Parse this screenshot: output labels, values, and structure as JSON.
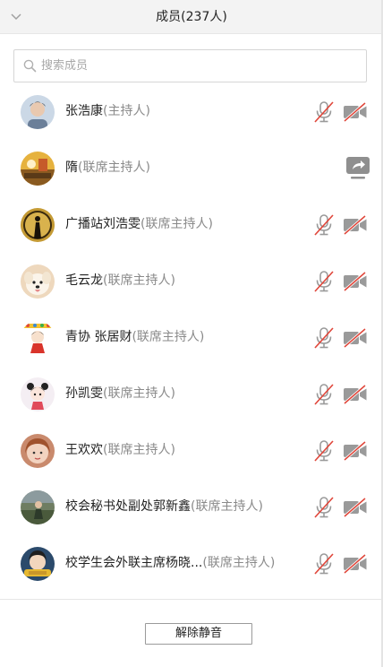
{
  "header": {
    "title": "成员(237人)",
    "collapse_icon": "chevron-down-icon"
  },
  "search": {
    "placeholder": "搜索成员",
    "value": "",
    "icon": "search-icon"
  },
  "members": [
    {
      "name": "张浩康",
      "role": "(主持人)",
      "mic": "muted",
      "camera": "off",
      "avatar_color": "#c9d7e6"
    },
    {
      "name": "隋",
      "role": "(联席主持人)",
      "status": "screen-sharing",
      "avatar_color": "#d9a53a"
    },
    {
      "name": "广播站刘浩雯",
      "role": "(联席主持人)",
      "mic": "muted",
      "camera": "off",
      "avatar_color": "#b38a2f"
    },
    {
      "name": "毛云龙",
      "role": "(联席主持人)",
      "mic": "muted",
      "camera": "off",
      "avatar_color": "#e8c6a0"
    },
    {
      "name": "青协 张居财",
      "role": "(联席主持人)",
      "mic": "muted",
      "camera": "off",
      "avatar_color": "#ffffff"
    },
    {
      "name": "孙凯雯",
      "role": "(联席主持人)",
      "mic": "muted",
      "camera": "off",
      "avatar_color": "#f3eef2"
    },
    {
      "name": "王欢欢",
      "role": "(联席主持人)",
      "mic": "muted",
      "camera": "off",
      "avatar_color": "#c98a6d"
    },
    {
      "name": "校会秘书处副处郭新鑫",
      "role": "(联席主持人)",
      "mic": "muted",
      "camera": "off",
      "avatar_color": "#5a6a4f"
    },
    {
      "name": "校学生会外联主席杨晓...",
      "role": "(联席主持人)",
      "mic": "muted",
      "camera": "off",
      "avatar_color": "#2b4a6b"
    }
  ],
  "footer": {
    "unmute_label": "解除静音"
  },
  "colors": {
    "mute_slash": "#e0463a",
    "icon_gray": "#9a9a9a",
    "role_gray": "#8a8a8a"
  }
}
